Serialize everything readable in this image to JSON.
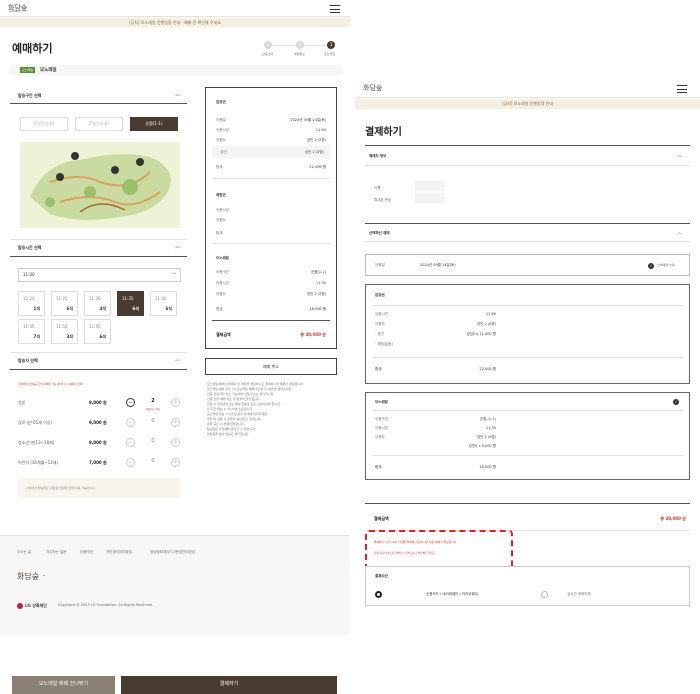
{
  "left": {
    "logo": "화담숲",
    "logo_sub": "HWADAMSUP",
    "banner": "[공지] 모노레일 운행일정 안내 · 예매 전 확인해 주세요",
    "title": "예매하기",
    "steps": [
      {
        "num": "1",
        "label": "관람선택"
      },
      {
        "num": "2",
        "label": "예매정보"
      },
      {
        "num": "3",
        "label": "모노레일"
      }
    ],
    "tag": "모노레일",
    "subtitle": "모노레일",
    "section_route": "탑승구간 선택",
    "route_buttons": [
      "1구간(승차)",
      "2구간(승차)",
      "순환(1-1)"
    ],
    "section_time": "탑승시간 선택",
    "time_select": "11:00",
    "slots": [
      {
        "time": "11:20",
        "count": "1석"
      },
      {
        "time": "11:25",
        "count": "6석"
      },
      {
        "time": "11:30",
        "count": "4석"
      },
      {
        "time": "11:35",
        "count": "6석"
      },
      {
        "time": "11:40",
        "count": "6석"
      },
      {
        "time": "11:45",
        "count": "7석"
      },
      {
        "time": "11:50",
        "count": "3석"
      },
      {
        "time": "11:55",
        "count": "6석"
      }
    ],
    "section_seat": "탑승자 선택",
    "seat_notice": "선택하신 탑승구간의 예매 가능 좌석 수 내에서 선택",
    "passengers": [
      {
        "label": "성인",
        "price": "9,000 원",
        "qty": "2",
        "note": "예매가능 6석"
      },
      {
        "label": "경로 (만 65세 이상)",
        "price": "9,000 원",
        "qty": "0"
      },
      {
        "label": "청소년 (만13~18세)",
        "price": "9,000 원",
        "qty": "0"
      },
      {
        "label": "어린이 (36개월~12세)",
        "price": "7,000 원",
        "qty": "0"
      }
    ],
    "info_note": "· 선택하신 탑승권은 관람일 당일에 한해 사용 가능합니다.",
    "summary": {
      "section1_title": "입장권",
      "rows1": [
        {
          "k": "이용일",
          "v": "2024년 09월 14일(토)"
        },
        {
          "k": "이용시간",
          "v": "11:00"
        },
        {
          "k": "이용자",
          "v": "성인 2 (2명)"
        },
        {
          "k": "· 성인",
          "v": "성인 2 (2명)"
        }
      ],
      "total1_k": "합계",
      "total1_v": "22,000 원",
      "section2_title": "체험권",
      "rows2": [
        {
          "k": "이용시간",
          "v": ""
        },
        {
          "k": "이용자",
          "v": ""
        }
      ],
      "total2_k": "합계",
      "section3_title": "모노레일",
      "rows3": [
        {
          "k": "이용구간",
          "v": "순환(1-1)"
        },
        {
          "k": "이용시간",
          "v": "11:35"
        },
        {
          "k": "이용자",
          "v": "성인 2 (2명)"
        },
        {
          "k": "합계",
          "v": "18,000 원"
        }
      ],
      "pay_k": "결제금액",
      "pay_v": "총 40,000 원",
      "cancel_btn": "예매 취소"
    },
    "bullets": [
      "· 모노레일(예매) [결제하기] 버튼을 클릭하시고 결제하시면 예매가 완료됩니다.",
      "· 모노레일 예매 취소 시 [모노레일 예매 취소하기] 버튼을 눌러주세요.",
      "  - 관람 전날까지 취소 가능하며 당일 취소는 불가합니다.",
      "  - 관람 당일 예매 취소 및 환불이 불가합니다.",
      "· 관람 시 입장권과 모노레일 탑승권 모두 소지하셔야 합니다.",
      "· 전 구간 탑승 시 약 20분 소요됩니다.",
      "· 모노레일 탑승 시 안전요원의 안내에 따라주세요.",
      "· 우천 및 강풍 시 운행이 중단될 수 있습니다.",
      "· 운행 중단 시 전액 환불됩니다.",
      "· 탑승권은 타인에게 양도할 수 없습니다.",
      "· 반려동물 동반 탑승은 불가합니다."
    ],
    "footer_links": [
      "오시는 길",
      "자주하는 질문",
      "이용약관",
      "개인정보처리방침",
      "영상정보처리기기운영관리방침"
    ],
    "footer_logo": "화담숲",
    "footer_brand": "LG 상록재단",
    "copyright": "Copyright © 2023 LG Foundation. All Rights Reserved.",
    "btn_left": "모노레일 예매 건너뛰기",
    "btn_right": "결제하기"
  },
  "right": {
    "logo": "화담숲",
    "banner": "[공지] 모노레일 운행일정 안내",
    "title": "결제하기",
    "sec_booker": "예매자 정보",
    "booker_rows": [
      "이름",
      "휴대폰 번호"
    ],
    "sec_selected": "선택하신 예매",
    "date_label": "이용일",
    "date_value": "2024년 09월 14일(토)",
    "date_check": "선택예매 선택",
    "card1": {
      "title": "입장권",
      "rows": [
        {
          "k": "이용시간",
          "v": "11:00"
        },
        {
          "k": "이용자",
          "v": "성인 2 (2명)"
        },
        {
          "k": "· 성인",
          "v": "성인2 x     11,000 원"
        },
        {
          "k": "· 체험(없음)",
          "v": ""
        }
      ],
      "total_k": "합계",
      "total_v": "22,000 원"
    },
    "card2": {
      "title": "모노레일",
      "rows": [
        {
          "k": "이용구간",
          "v": "순환 (1-1)"
        },
        {
          "k": "이용시간",
          "v": "11:35"
        },
        {
          "k": "이용자",
          "v": "성인 2 (2명)"
        },
        {
          "k": "",
          "v": "성인2 x      9,000 원"
        }
      ],
      "total_k": "합계",
      "total_v": "18,000 원"
    },
    "pay_k": "결제금액",
    "pay_v": "총 40,000 원",
    "notes": [
      "· 결제하신 시간 12분 이내에 결제를 완료하시면 정상 예매가 완료됩니다.",
      "· 유의 사항 안내 후 결제가 진행되오니 확인해 주세요."
    ],
    "sec_payment": "결제수단",
    "pay_methods": [
      "신용카드 / 네이버페이 / 카카오페이",
      "실시간 계좌이체"
    ]
  },
  "colors": {
    "brand": "#4a3b30",
    "accent_red": "#d33c2a",
    "green": "#5c8a3a",
    "banner": "#f3efe3",
    "highlight": "#e02020"
  }
}
